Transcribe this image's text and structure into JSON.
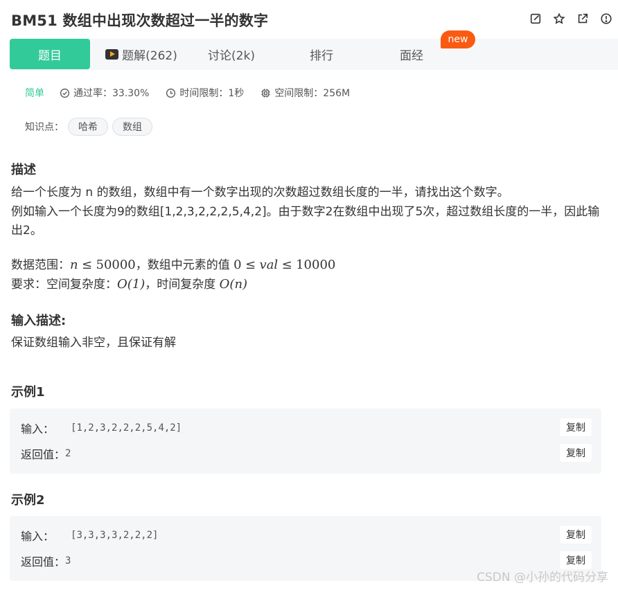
{
  "header": {
    "title": "BM51  数组中出现次数超过一半的数字",
    "icons": [
      "edit-icon",
      "star-icon",
      "external-link-icon",
      "alert-icon"
    ]
  },
  "tabs": [
    {
      "label": "题目",
      "active": true
    },
    {
      "label": "题解(262)",
      "icon": "video-icon"
    },
    {
      "label": "讨论(2k)"
    },
    {
      "label": "排行"
    },
    {
      "label": "面经"
    }
  ],
  "new_badge": "new",
  "meta": {
    "difficulty": "简单",
    "pass_rate": "通过率：33.30%",
    "time_limit": "时间限制：1秒",
    "space_limit": "空间限制：256M"
  },
  "knowledge": {
    "label": "知识点：",
    "tags": [
      "哈希",
      "数组"
    ]
  },
  "description": {
    "heading": "描述",
    "line1": "给一个长度为 n 的数组，数组中有一个数字出现的次数超过数组长度的一半，请找出这个数字。",
    "line2": "例如输入一个长度为9的数组[1,2,3,2,2,2,5,4,2]。由于数字2在数组中出现了5次，超过数组长度的一半，因此输",
    "line3": "出2。",
    "range_prefix": "数据范围：",
    "range_n": "n",
    "range_le": "≤",
    "range_n_max": "50000",
    "range_mid": "，数组中元素的值 ",
    "range_zero": "0",
    "range_val": "val",
    "range_val_max": "10000",
    "req_prefix": "要求：空间复杂度：",
    "req_space": "O(1)",
    "req_mid": "，时间复杂度 ",
    "req_time": "O(n)"
  },
  "input_desc": {
    "heading": "输入描述:",
    "text": "保证数组输入非空，且保证有解"
  },
  "examples": [
    {
      "heading": "示例1",
      "input_label": "输入：",
      "input_value": "[1,2,3,2,2,2,5,4,2]",
      "output_label": "返回值：",
      "output_value": "2",
      "copy_label": "复制"
    },
    {
      "heading": "示例2",
      "input_label": "输入：",
      "input_value": "[3,3,3,3,2,2,2]",
      "output_label": "返回值：",
      "output_value": "3",
      "copy_label": "复制"
    }
  ],
  "watermark": "CSDN @小孙的代码分享",
  "colors": {
    "accent": "#32ca99",
    "new_badge": "#fa5a12",
    "block_bg": "#f5f6f8"
  }
}
